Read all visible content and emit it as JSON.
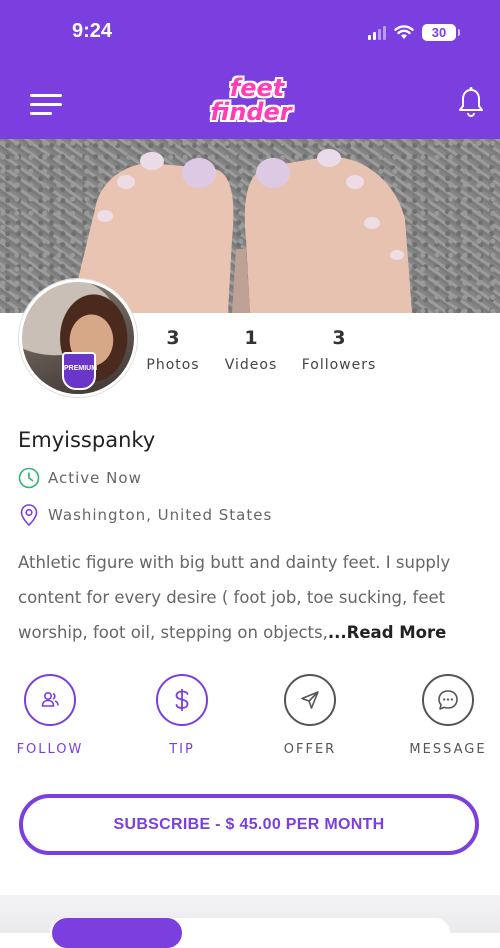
{
  "status_bar": {
    "time": "9:24",
    "battery": "30"
  },
  "header": {
    "logo_line1": "feet",
    "logo_line2": "finder"
  },
  "profile": {
    "badge": "PREMIUM",
    "username": "Emyisspanky",
    "stats": [
      {
        "value": "3",
        "label": "Photos"
      },
      {
        "value": "1",
        "label": "Videos"
      },
      {
        "value": "3",
        "label": "Followers"
      }
    ],
    "activity": "Active Now",
    "location": "Washington, United States",
    "bio": {
      "lines": [
        "Athletic figure with big butt and dainty feet. I supply",
        "content for every desire ( foot job, toe sucking, feet",
        "worship, foot oil, stepping on objects,"
      ],
      "more": "...Read More"
    }
  },
  "actions": [
    {
      "label": "FOLLOW",
      "icon": "users-icon"
    },
    {
      "label": "TIP",
      "icon": "dollar-icon"
    },
    {
      "label": "OFFER",
      "icon": "send-icon"
    },
    {
      "label": "MESSAGE",
      "icon": "chat-icon"
    }
  ],
  "subscribe": {
    "label": "SUBSCRIBE - $ 45.00 PER MONTH"
  },
  "colors": {
    "brand": "#7b3fe0",
    "logo_pink": "#ff3db5",
    "active_green": "#2bb673"
  }
}
